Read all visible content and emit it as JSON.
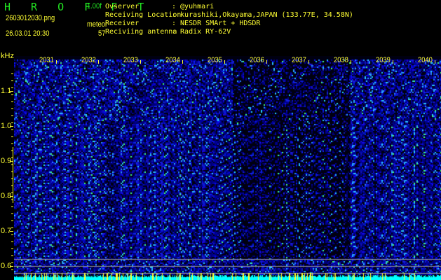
{
  "app": {
    "title": "H R O F F T",
    "version": "1.00f"
  },
  "file": {
    "name": "2603012030.png",
    "datetime": "26.03.01 20:30"
  },
  "meteor": {
    "label": "meteor",
    "count": "57"
  },
  "info": [
    {
      "key": "Ovserver",
      "value": ": @yuhmari"
    },
    {
      "key": "Receiving Location",
      "value": ": kurashiki,Okayama,JAPAN (133.77E, 34.58N)"
    },
    {
      "key": "Receiver",
      "value": ": NESDR SMArt + HDSDR"
    },
    {
      "key": "Reciviing antenna",
      "value": ": Radix RY-62V"
    }
  ],
  "axis": {
    "unit": "kHz",
    "y_labels": [
      "1.1",
      "1.0",
      "0.9",
      "0.8",
      "0.7",
      "0.6"
    ],
    "time_labels": [
      "2031",
      "2032",
      "2033",
      "2034",
      "2035",
      "2036",
      "2037",
      "2038",
      "2039",
      "2040"
    ]
  },
  "colors": {
    "accent_text": "#ffff33",
    "title": "#22e622",
    "signal_floor": "#00ffff"
  }
}
